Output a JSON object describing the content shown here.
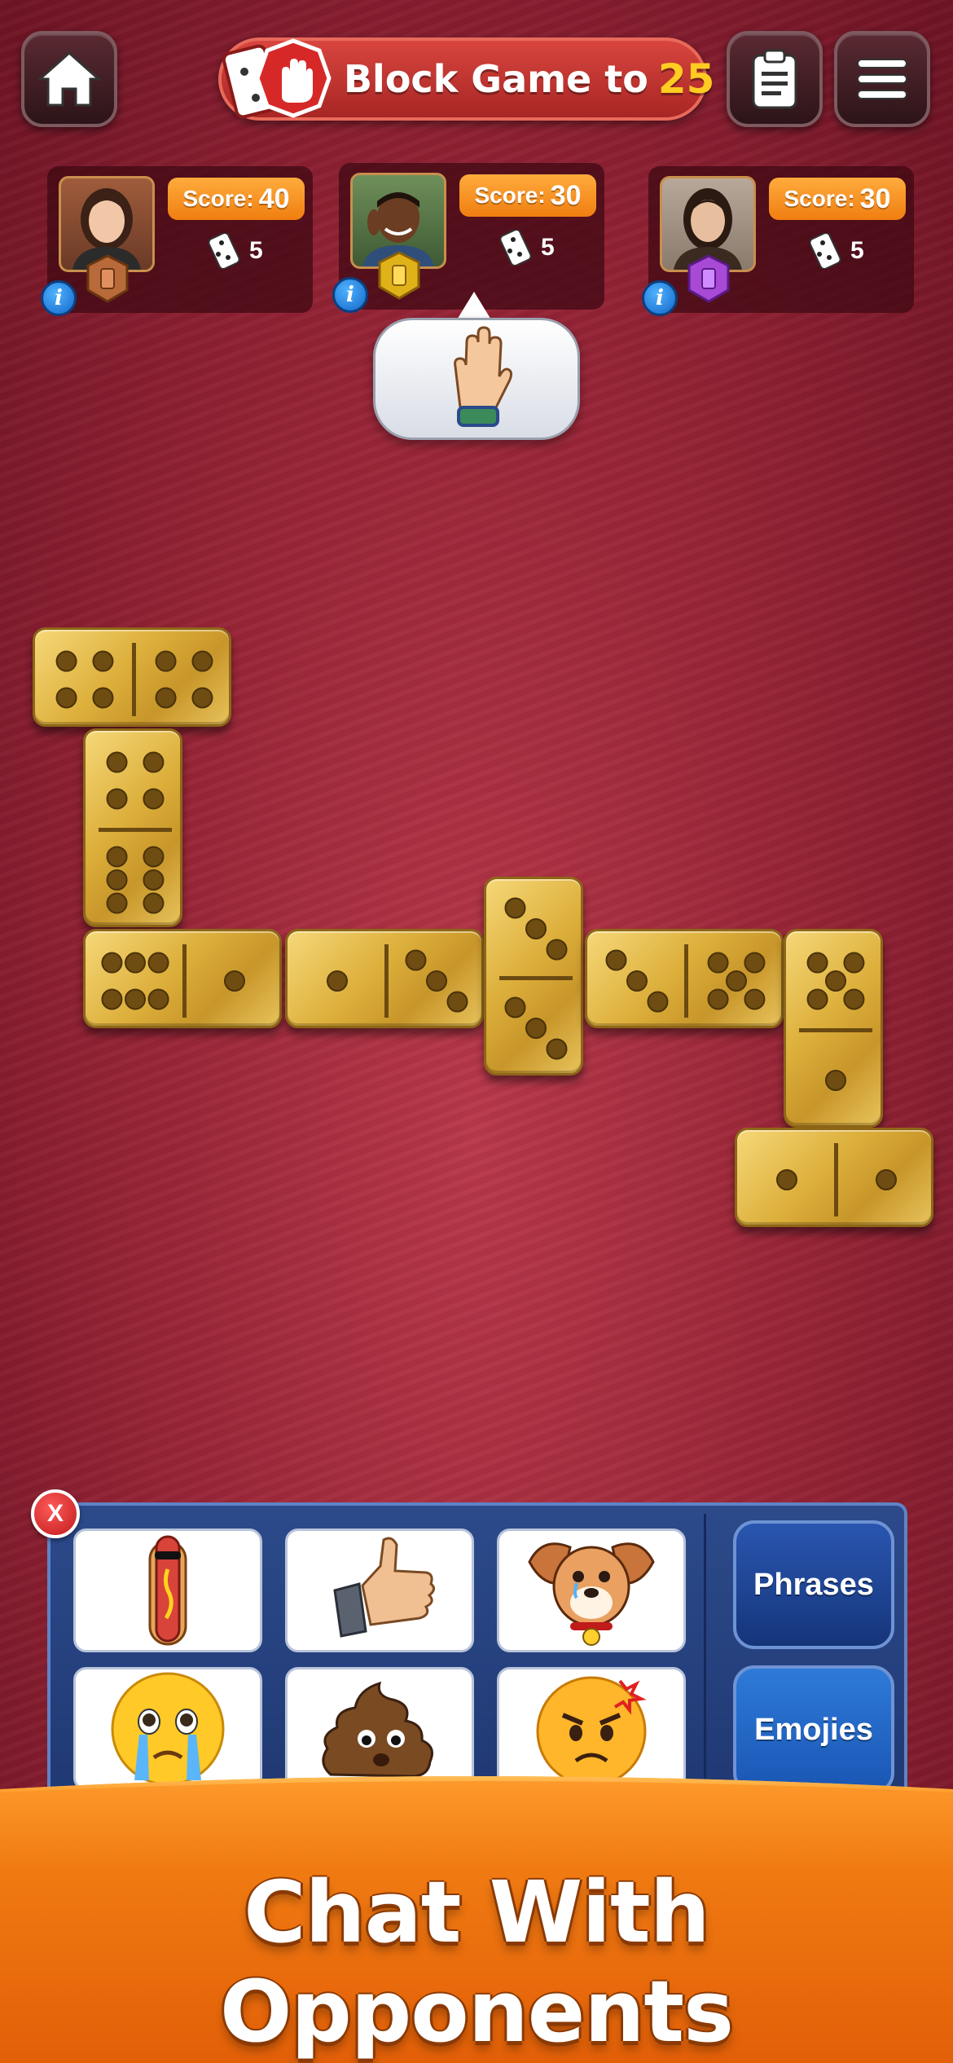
{
  "header": {
    "title_prefix": "Block Game to",
    "target_score": "25",
    "home_icon": "home-icon",
    "scoreboard_icon": "clipboard-icon",
    "menu_icon": "hamburger-menu-icon",
    "block_icon": "stop-hand-icon"
  },
  "players": [
    {
      "score_label": "Score:",
      "score": "40",
      "tiles_left": "5",
      "rank_color": "#b86a3a",
      "avatar": "woman-avatar"
    },
    {
      "score_label": "Score:",
      "score": "30",
      "tiles_left": "5",
      "rank_color": "#e0b21a",
      "avatar": "man-avatar"
    },
    {
      "score_label": "Score:",
      "score": "30",
      "tiles_left": "5",
      "rank_color": "#a84ad6",
      "avatar": "woman-avatar"
    }
  ],
  "speech_bubble": {
    "emote": "raised-hand-icon"
  },
  "board": {
    "tiles": [
      {
        "a": 4,
        "b": 4
      },
      {
        "a": 4,
        "b": 6
      },
      {
        "a": 6,
        "b": 1
      },
      {
        "a": 1,
        "b": 3
      },
      {
        "a": 3,
        "b": 3
      },
      {
        "a": 3,
        "b": 5
      },
      {
        "a": 5,
        "b": 1
      },
      {
        "a": 1,
        "b": 1
      }
    ]
  },
  "chat": {
    "close_label": "X",
    "stickers": [
      "hotdog-sticker",
      "thumbs-up-sticker",
      "crying-dog-sticker",
      "crying-face-sticker",
      "poop-sticker",
      "angry-face-sticker"
    ],
    "phrases_label": "Phrases",
    "emojies_label": "Emojies"
  },
  "banner": {
    "text": "Chat With Opponents"
  },
  "colors": {
    "felt": "#9a2638",
    "accent_orange": "#f07e10",
    "chat_blue": "#1e3670",
    "title_red": "#c8302c"
  }
}
